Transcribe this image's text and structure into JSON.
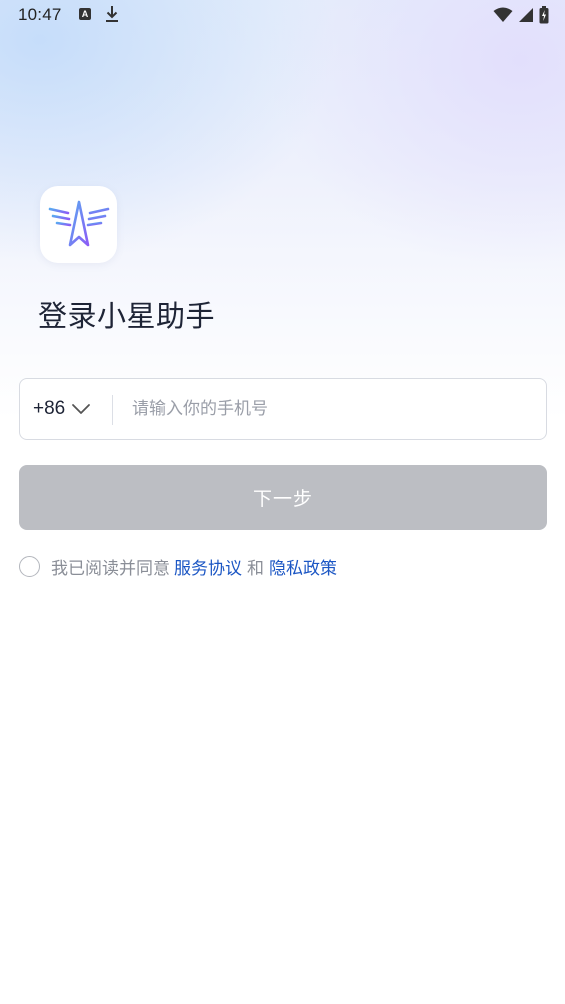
{
  "status_bar": {
    "time": "10:47",
    "left_icons": [
      "a-notification-icon",
      "download-icon"
    ],
    "right_icons": [
      "wifi-icon",
      "cellular-signal-icon",
      "battery-charging-icon"
    ]
  },
  "app": {
    "logo_icon": "winged-star-logo-icon",
    "title": "登录小星助手"
  },
  "phone": {
    "country_code": "+86",
    "placeholder": "请输入你的手机号",
    "value": ""
  },
  "next_button": {
    "label": "下一步",
    "disabled": true
  },
  "agreement": {
    "checked": false,
    "prefix": "我已阅读并同意",
    "terms_link": "服务协议",
    "and": "和",
    "privacy_link": "隐私政策"
  },
  "colors": {
    "title": "#1e2436",
    "link": "#1b56c4",
    "button_disabled": "#bcbec3",
    "muted_text": "#8a8e97"
  }
}
